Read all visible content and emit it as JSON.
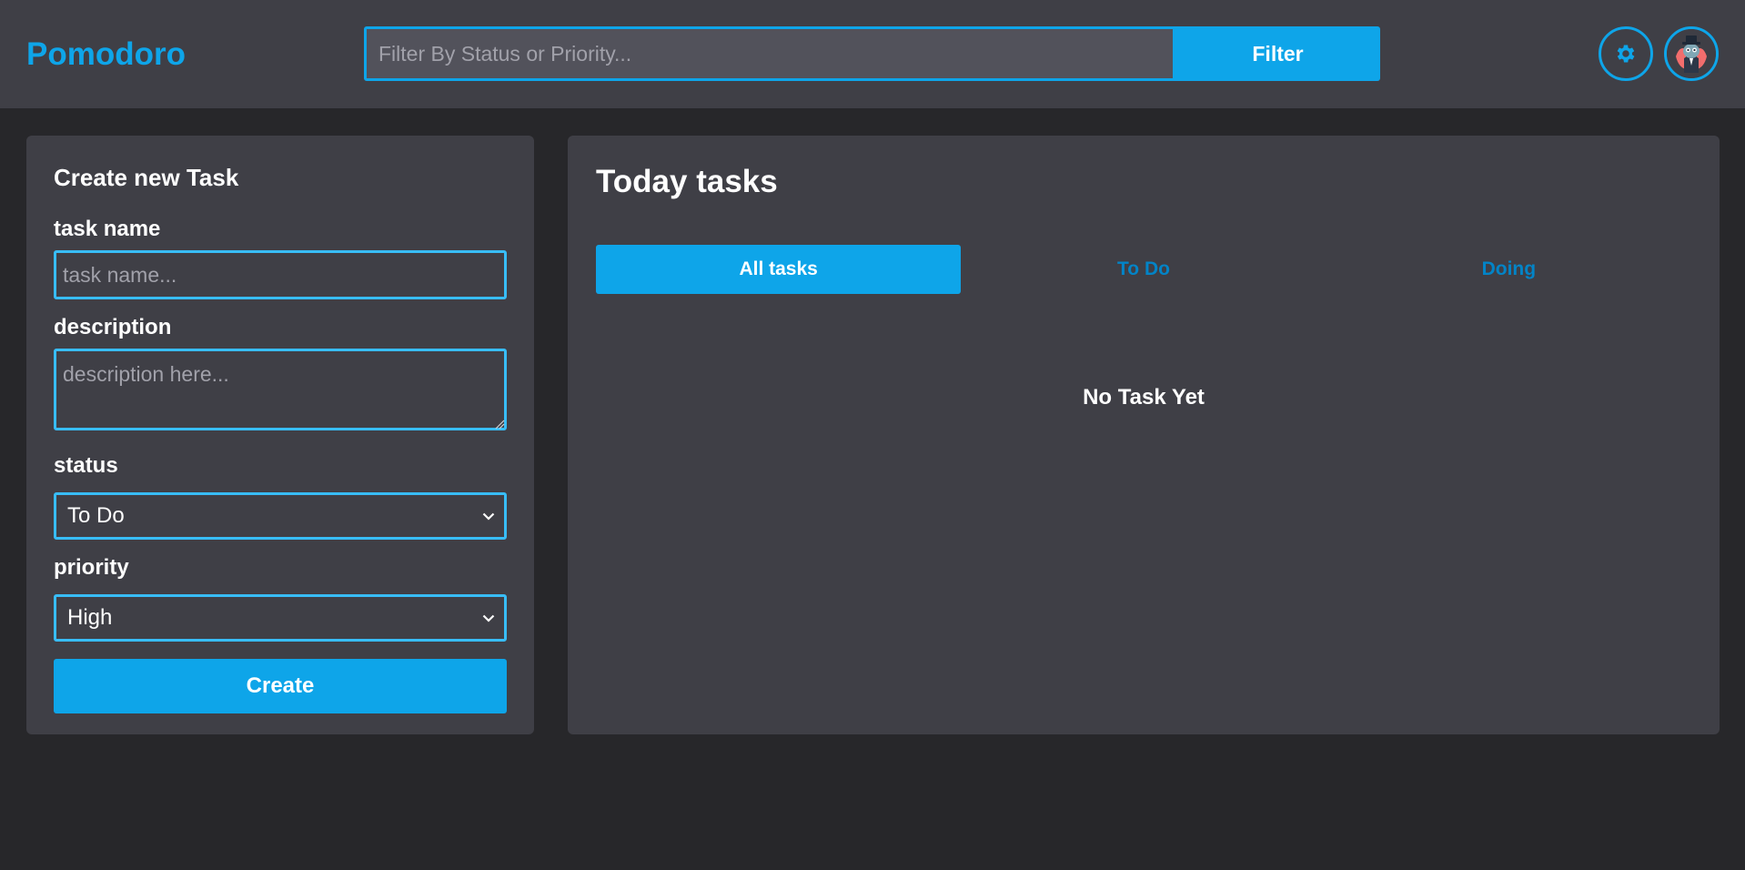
{
  "header": {
    "logo": "Pomodoro",
    "search": {
      "placeholder": "Filter By Status or Priority...",
      "value": ""
    },
    "filter_label": "Filter",
    "settings_icon": "gear-icon",
    "avatar_icon": "avatar-icon"
  },
  "create_form": {
    "title": "Create new Task",
    "task_name": {
      "label": "task name",
      "placeholder": "task name...",
      "value": ""
    },
    "description": {
      "label": "description",
      "placeholder": "description here...",
      "value": ""
    },
    "status": {
      "label": "status",
      "selected": "To Do"
    },
    "priority": {
      "label": "priority",
      "selected": "High"
    },
    "submit_label": "Create"
  },
  "tasks_panel": {
    "title": "Today tasks",
    "tabs": [
      {
        "label": "All tasks",
        "active": true
      },
      {
        "label": "To Do",
        "active": false
      },
      {
        "label": "Doing",
        "active": false
      }
    ],
    "empty_message": "No Task Yet"
  },
  "colors": {
    "accent": "#0ea5e9",
    "tab_inactive_text": "#0284c7",
    "header_bg": "#3f3f46",
    "page_bg": "#27272a",
    "card_bg": "#3f3f46",
    "input_border": "#38bdf8"
  }
}
